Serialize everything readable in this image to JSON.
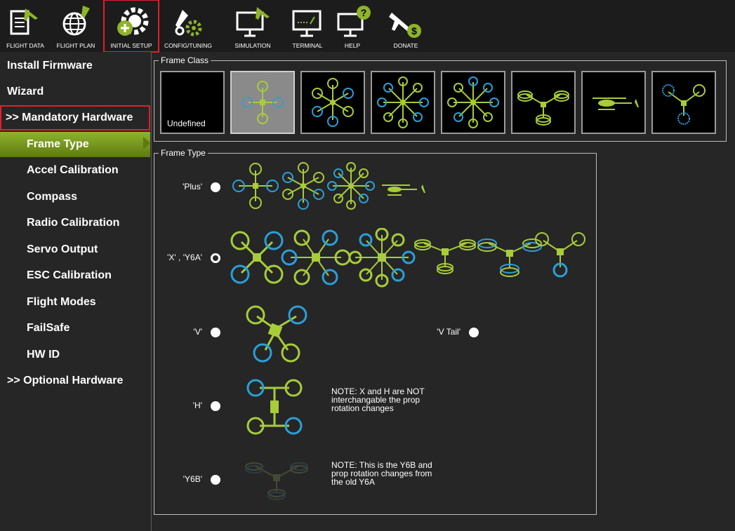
{
  "toolbar": {
    "buttons": [
      {
        "label": "FLIGHT DATA"
      },
      {
        "label": "FLIGHT PLAN"
      },
      {
        "label": "INITIAL SETUP"
      },
      {
        "label": "CONFIG/TUNING"
      },
      {
        "label": "SIMULATION"
      },
      {
        "label": "TERMINAL"
      },
      {
        "label": "HELP"
      },
      {
        "label": "DONATE"
      }
    ]
  },
  "sidebar": {
    "items": [
      {
        "label": "Install Firmware"
      },
      {
        "label": "Wizard"
      },
      {
        "label": ">> Mandatory Hardware"
      },
      {
        "label": "Frame Type"
      },
      {
        "label": "Accel Calibration"
      },
      {
        "label": "Compass"
      },
      {
        "label": "Radio Calibration"
      },
      {
        "label": "Servo Output"
      },
      {
        "label": "ESC Calibration"
      },
      {
        "label": "Flight Modes"
      },
      {
        "label": "FailSafe"
      },
      {
        "label": "HW ID"
      },
      {
        "label": ">> Optional Hardware"
      }
    ]
  },
  "frame_class": {
    "title": "Frame Class",
    "undefined_label": "Undefined"
  },
  "frame_type": {
    "title": "Frame Type",
    "options": [
      {
        "label": "'Plus'",
        "checked": false
      },
      {
        "label": "'X' , 'Y6A'",
        "checked": true
      },
      {
        "label": "'V'",
        "checked": false
      },
      {
        "label": "'V Tail'",
        "checked": false
      },
      {
        "label": "'H'",
        "checked": false
      },
      {
        "label": "'Y6B'",
        "checked": false
      }
    ],
    "note_h": [
      "NOTE: X and H are NOT",
      "interchangable the prop",
      "rotation changes"
    ],
    "note_y6b": [
      "NOTE: This is the Y6B and",
      "prop rotation changes from",
      "the old Y6A"
    ]
  },
  "colors": {
    "accent": "#8fb32a",
    "prop_green": "#a8cc3a",
    "prop_blue": "#2a9fd8",
    "selection": "#e0202a"
  }
}
